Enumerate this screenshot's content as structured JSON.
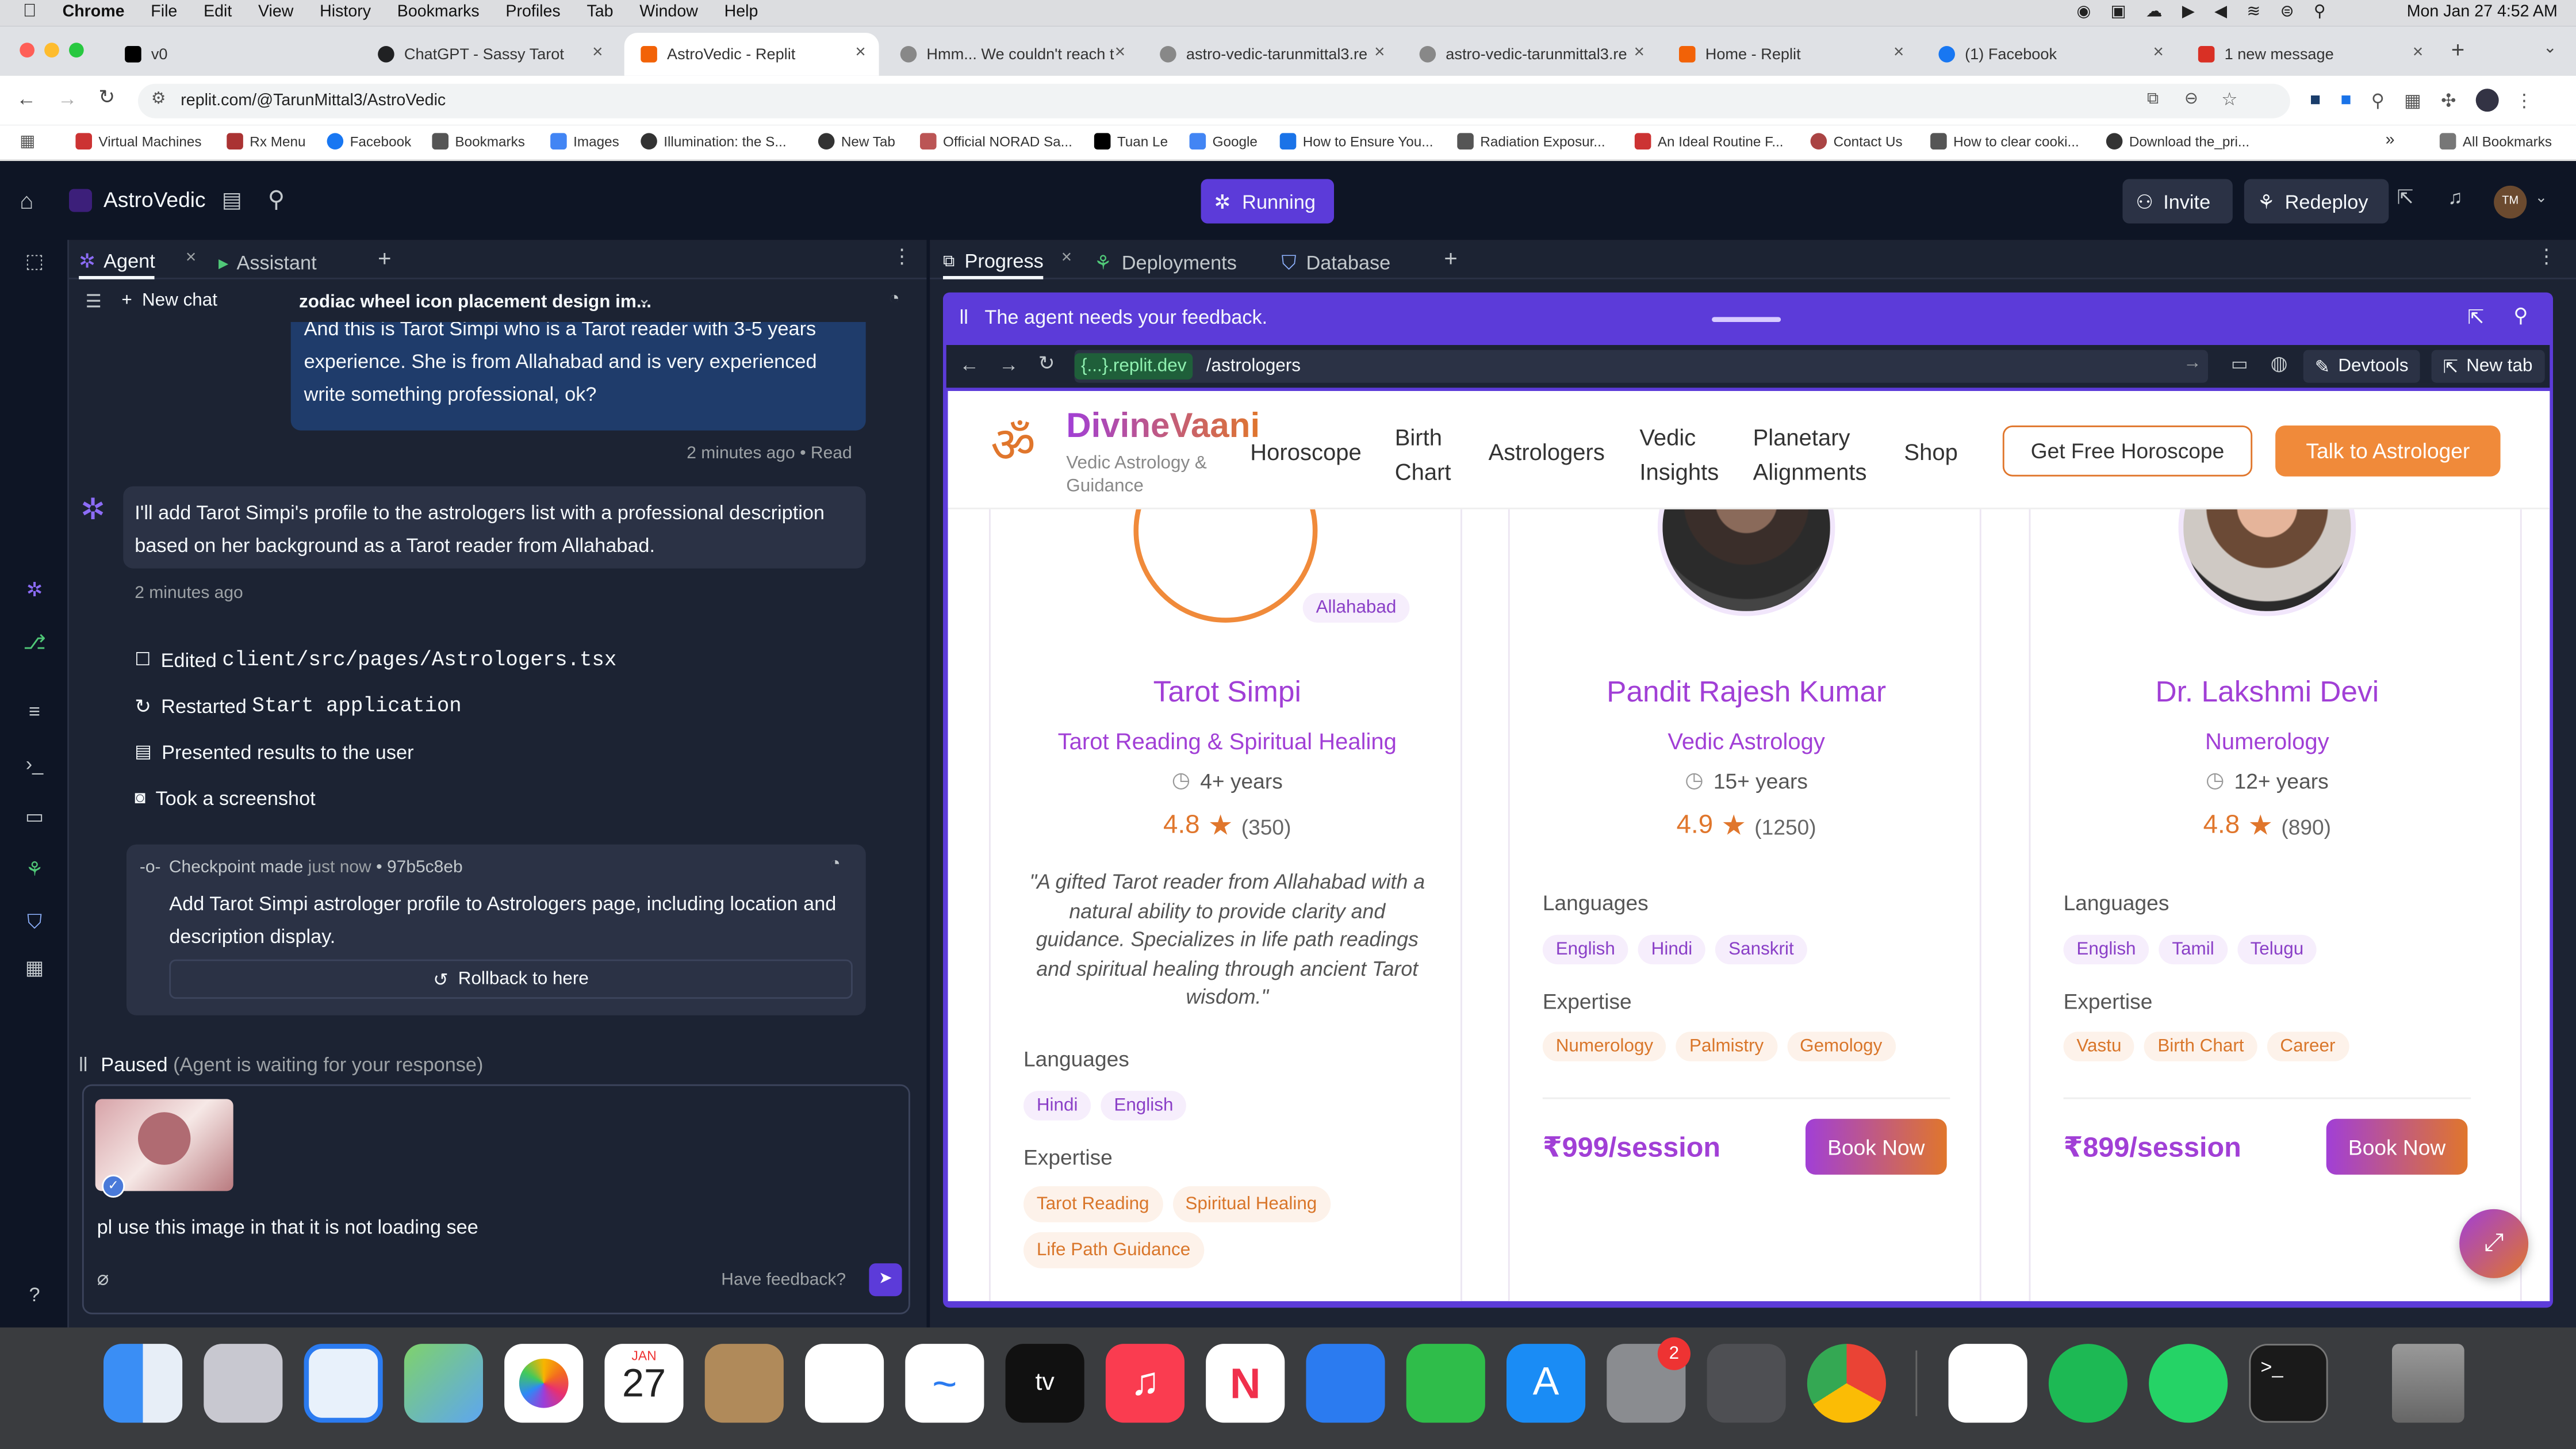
{
  "menubar": {
    "apple": "",
    "items": [
      "Chrome",
      "File",
      "Edit",
      "View",
      "History",
      "Bookmarks",
      "Profiles",
      "Tab",
      "Window",
      "Help"
    ],
    "clock": "Mon Jan 27  4:52 AM"
  },
  "tabs": [
    {
      "label": "v0",
      "color": "#000000"
    },
    {
      "label": "ChatGPT - Sassy Tarot",
      "color": "#202123"
    },
    {
      "label": "AstroVedic - Replit",
      "color": "#f26207"
    },
    {
      "label": "Hmm... We couldn't reach t",
      "color": "#888888"
    },
    {
      "label": "astro-vedic-tarunmittal3.re",
      "color": "#888888"
    },
    {
      "label": "astro-vedic-tarunmittal3.re",
      "color": "#888888"
    },
    {
      "label": "Home - Replit",
      "color": "#f26207"
    },
    {
      "label": "(1) Facebook",
      "color": "#1877f2"
    },
    {
      "label": "1 new message",
      "color": "#d93025"
    }
  ],
  "address": {
    "url": "replit.com/@TarunMittal3/AstroVedic"
  },
  "bookmarks": [
    "Virtual Machines",
    "Rx Menu",
    "Facebook",
    "Bookmarks",
    "Images",
    "Illumination: the S...",
    "New Tab",
    "Official NORAD Sa...",
    "Tuan Le",
    "Google",
    "How to Ensure You...",
    "Radiation Exposur...",
    "An Ideal Routine F...",
    "Contact Us",
    "How to clear cooki...",
    "Download the_pri...",
    "All Bookmarks"
  ],
  "replit": {
    "project": "AstroVedic",
    "run_status": "Running",
    "invite": "Invite",
    "redeploy": "Redeploy",
    "avatar": "TM"
  },
  "agent": {
    "tab_agent": "Agent",
    "tab_assistant": "Assistant",
    "new_chat": "New chat",
    "chat_title": "zodiac wheel icon placement design im...",
    "user_msg": "And this is Tarot Simpi who is a Tarot reader with 3-5 years experience. She is from Allahabad and is very experienced write something professional, ok?",
    "user_meta": "2 minutes ago • Read",
    "agent_msg": "I'll add Tarot Simpi's profile to the astrologers list with a professional description based on her background as a Tarot reader from Allahabad.",
    "agent_meta": "2 minutes ago",
    "actions": [
      {
        "verb": "Edited",
        "arg": "client/src/pages/Astrologers.tsx"
      },
      {
        "verb": "Restarted",
        "arg": "Start application"
      },
      {
        "verb": "Presented results to the user",
        "arg": ""
      },
      {
        "verb": "Took a screenshot",
        "arg": ""
      }
    ],
    "checkpoint_label": "Checkpoint made",
    "checkpoint_time": "just now",
    "checkpoint_hash": "97b5c8eb",
    "checkpoint_desc": "Add Tarot Simpi astrologer profile to Astrologers page, including location and description display.",
    "rollback": "Rollback to here",
    "paused": "Paused",
    "paused_note": "(Agent is waiting for your response)",
    "input_text": "pl use this image in that it is not loading see",
    "feedback": "Have feedback?"
  },
  "right": {
    "tab_progress": "Progress",
    "tab_deployments": "Deployments",
    "tab_database": "Database",
    "banner": "The agent needs your feedback.",
    "preview_domain": "{...}.replit.dev",
    "preview_path": "/astrologers",
    "devtools": "Devtools",
    "newtab": "New tab"
  },
  "site": {
    "brand": "DivineVaani",
    "tagline": "Vedic Astrology & Guidance",
    "nav": [
      "Horoscope",
      "Birth Chart",
      "Astrologers",
      "Vedic Insights",
      "Planetary Alignments",
      "Shop"
    ],
    "cta_outline": "Get Free Horoscope",
    "cta_fill": "Talk to Astrologer",
    "labels": {
      "languages": "Languages",
      "expertise": "Expertise",
      "book": "Book Now"
    },
    "cards": [
      {
        "name": "Tarot Simpi",
        "specialty": "Tarot Reading & Spiritual Healing",
        "experience": "4+ years",
        "rating": "4.8",
        "reviews": "(350)",
        "location": "Allahabad",
        "description": "\"A gifted Tarot reader from Allahabad with a natural ability to provide clarity and guidance. Specializes in life path readings and spiritual healing through ancient Tarot wisdom.\"",
        "languages": [
          "Hindi",
          "English"
        ],
        "expertise": [
          "Tarot Reading",
          "Spiritual Healing",
          "Life Path Guidance"
        ],
        "price": ""
      },
      {
        "name": "Pandit Rajesh Kumar",
        "specialty": "Vedic Astrology",
        "experience": "15+ years",
        "rating": "4.9",
        "reviews": "(1250)",
        "location": "",
        "description": "",
        "languages": [
          "English",
          "Hindi",
          "Sanskrit"
        ],
        "expertise": [
          "Numerology",
          "Palmistry",
          "Gemology"
        ],
        "price": "₹999/session"
      },
      {
        "name": "Dr. Lakshmi Devi",
        "specialty": "Numerology",
        "experience": "12+ years",
        "rating": "4.8",
        "reviews": "(890)",
        "location": "",
        "description": "",
        "languages": [
          "English",
          "Tamil",
          "Telugu"
        ],
        "expertise": [
          "Vastu",
          "Birth Chart",
          "Career"
        ],
        "price": "₹899/session"
      }
    ]
  },
  "dock": {
    "calendar_month": "JAN",
    "calendar_day": "27",
    "settings_badge": "2"
  },
  "colors": {
    "replit_bg": "#0e1525",
    "panel": "#1c2333",
    "accent": "#5c3bd9",
    "orange": "#e0762c",
    "purple": "#a13fd6"
  }
}
